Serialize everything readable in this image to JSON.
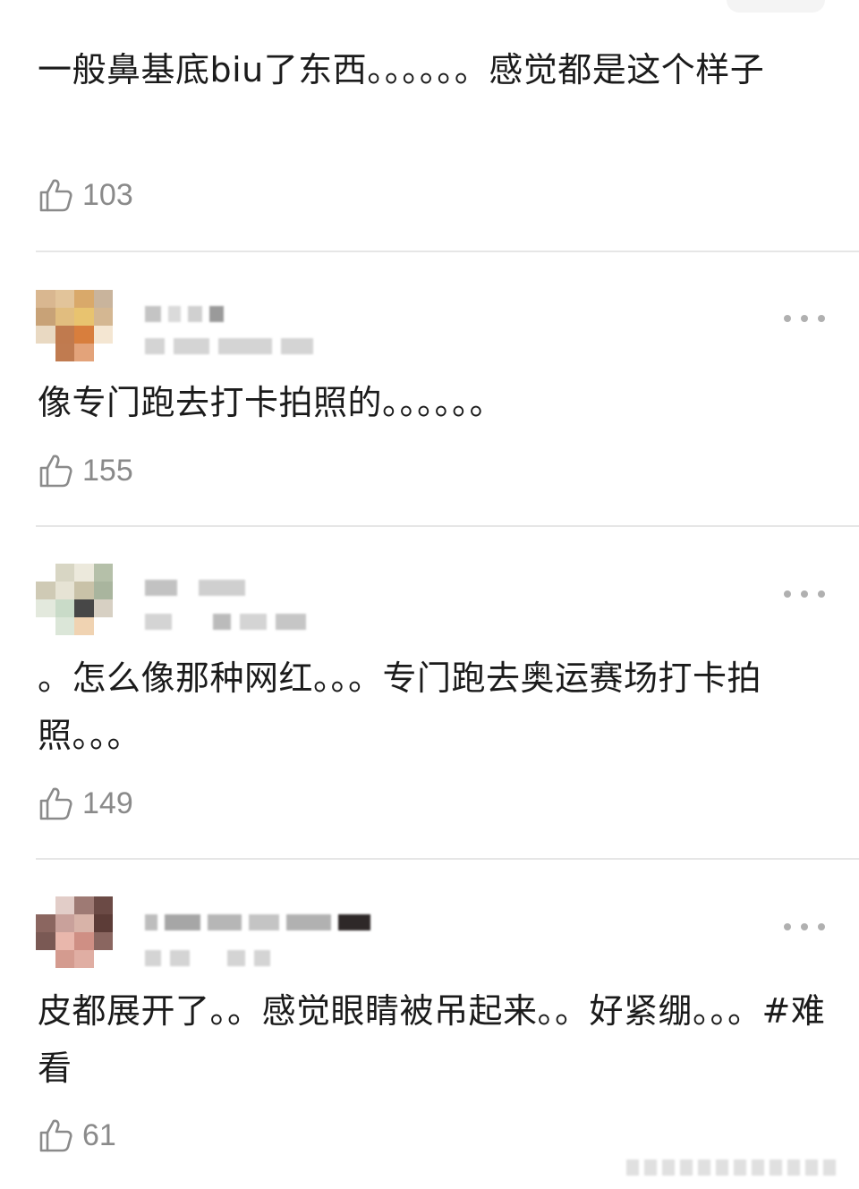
{
  "comments": [
    {
      "text": "一般鼻基底biu了东西。。。。。。感觉都是这个样子",
      "likes": "103",
      "has_header": false
    },
    {
      "text": "像专门跑去打卡拍照的。。。。。。",
      "likes": "155",
      "has_header": true
    },
    {
      "text": "。怎么像那种网红。。。专门跑去奥运赛场打卡拍照。。。",
      "likes": "149",
      "has_header": true
    },
    {
      "text": "皮都展开了。。感觉眼睛被吊起来。。好紧绷。。。#难看",
      "likes": "61",
      "has_header": true
    }
  ],
  "icons": {
    "like": "thumbs-up-icon",
    "more": "more-dots-icon"
  },
  "colors": {
    "text": "#1b1b1b",
    "muted": "#8a8a8a",
    "divider": "#e6e6e6",
    "dots": "#b0b0b0"
  }
}
